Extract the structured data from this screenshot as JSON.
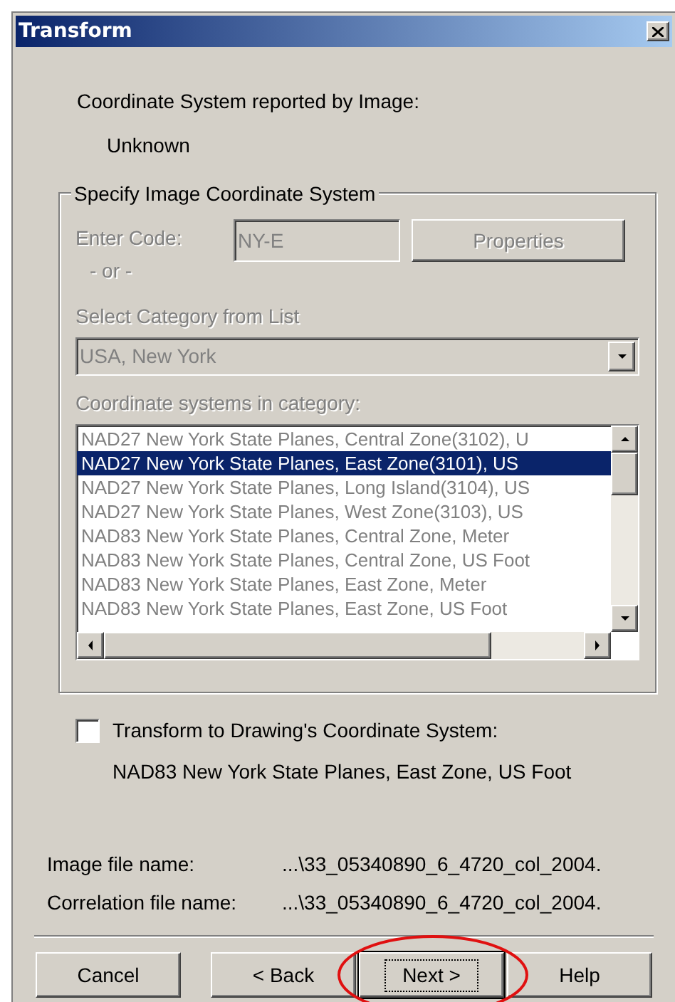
{
  "window": {
    "title": "Transform"
  },
  "reported": {
    "label": "Coordinate System reported by Image:",
    "value": "Unknown"
  },
  "group": {
    "title": "Specify Image Coordinate System",
    "code": {
      "label": "Enter Code:",
      "value": "NY-E",
      "disabled": true
    },
    "or_text": "- or -",
    "properties_button": {
      "label": "Properties",
      "disabled": true
    },
    "category": {
      "label": "Select Category from List",
      "value": "USA, New York",
      "disabled": true
    },
    "systems": {
      "label": "Coordinate systems in category:",
      "disabled": true,
      "items": [
        {
          "label": "NAD27 New York State Planes, Central Zone(3102), U",
          "selected": false
        },
        {
          "label": "NAD27 New York State Planes, East Zone(3101), US",
          "selected": true
        },
        {
          "label": "NAD27 New York State Planes, Long Island(3104), US",
          "selected": false
        },
        {
          "label": "NAD27 New York State Planes, West Zone(3103), US",
          "selected": false
        },
        {
          "label": "NAD83 New York State Planes, Central Zone, Meter",
          "selected": false
        },
        {
          "label": "NAD83 New York State Planes, Central Zone, US Foot",
          "selected": false
        },
        {
          "label": "NAD83 New York State Planes, East Zone, Meter",
          "selected": false
        },
        {
          "label": "NAD83 New York State Planes, East Zone, US Foot",
          "selected": false
        }
      ]
    }
  },
  "transform": {
    "label": "Transform to Drawing's Coordinate System:",
    "checked": false,
    "system": "NAD83 New York State Planes, East Zone, US Foot"
  },
  "files": [
    {
      "label": "Image file name:",
      "value": "...\\33_05340890_6_4720_col_2004."
    },
    {
      "label": "Correlation file name:",
      "value": "...\\33_05340890_6_4720_col_2004."
    }
  ],
  "buttons": [
    {
      "label": "Cancel",
      "default": false,
      "highlighted": false
    },
    {
      "label": "< Back",
      "default": false,
      "highlighted": false
    },
    {
      "label": "Next >",
      "default": true,
      "highlighted": true
    },
    {
      "label": "Help",
      "default": false,
      "highlighted": false
    }
  ]
}
